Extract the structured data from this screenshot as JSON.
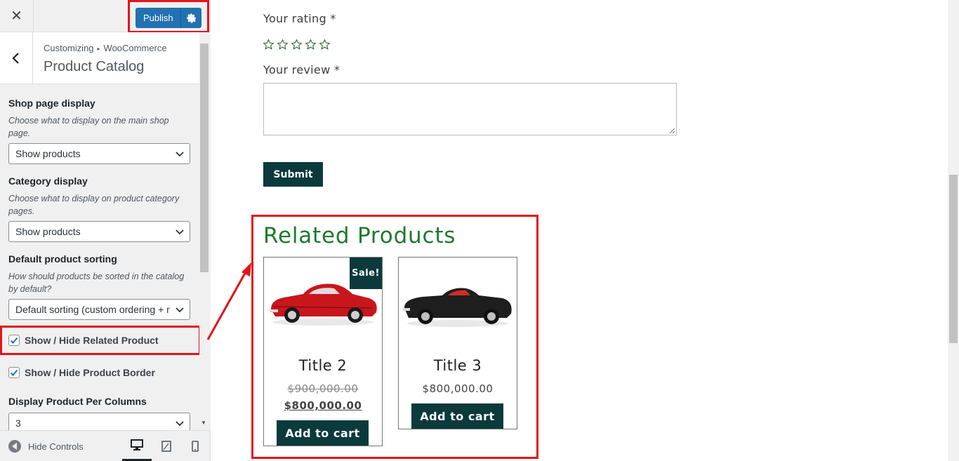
{
  "topbar": {
    "close_label": "✕",
    "publish_label": "Publish"
  },
  "section": {
    "breadcrumb_root": "Customizing",
    "breadcrumb_sep": "▸",
    "breadcrumb_parent": "WooCommerce",
    "title": "Product Catalog"
  },
  "controls": {
    "shop_display": {
      "title": "Shop page display",
      "description": "Choose what to display on the main shop page.",
      "value": "Show products"
    },
    "category_display": {
      "title": "Category display",
      "description": "Choose what to display on product category pages.",
      "value": "Show products"
    },
    "sorting": {
      "title": "Default product sorting",
      "description": "How should products be sorted in the catalog by default?",
      "value": "Default sorting (custom ordering + r"
    },
    "related_toggle": {
      "label": "Show / Hide Related Product",
      "checked": true
    },
    "border_toggle": {
      "label": "Show / Hide Product Border",
      "checked": true
    },
    "per_columns": {
      "title": "Display Product Per Columns",
      "value": "3"
    }
  },
  "footer": {
    "hide_controls_label": "Hide Controls"
  },
  "preview": {
    "rating_label": "Your rating *",
    "rating_value": 0,
    "rating_max": 5,
    "review_label": "Your review *",
    "review_value": "",
    "submit_label": "Submit",
    "related_title": "Related Products",
    "products": [
      {
        "title": "Title 2",
        "sale_badge": "Sale!",
        "old_price": "$900,000.00",
        "price": "$800,000.00",
        "button": "Add to cart",
        "car_color": "#c8161d"
      },
      {
        "title": "Title 3",
        "price": "$800,000.00",
        "button": "Add to cart",
        "car_color": "#1e1e1e"
      }
    ]
  },
  "colors": {
    "publish_blue": "#2271b1",
    "highlight_red": "#e3141b",
    "dark_teal": "#0b3a3c",
    "heading_green": "#1f7a2e"
  }
}
